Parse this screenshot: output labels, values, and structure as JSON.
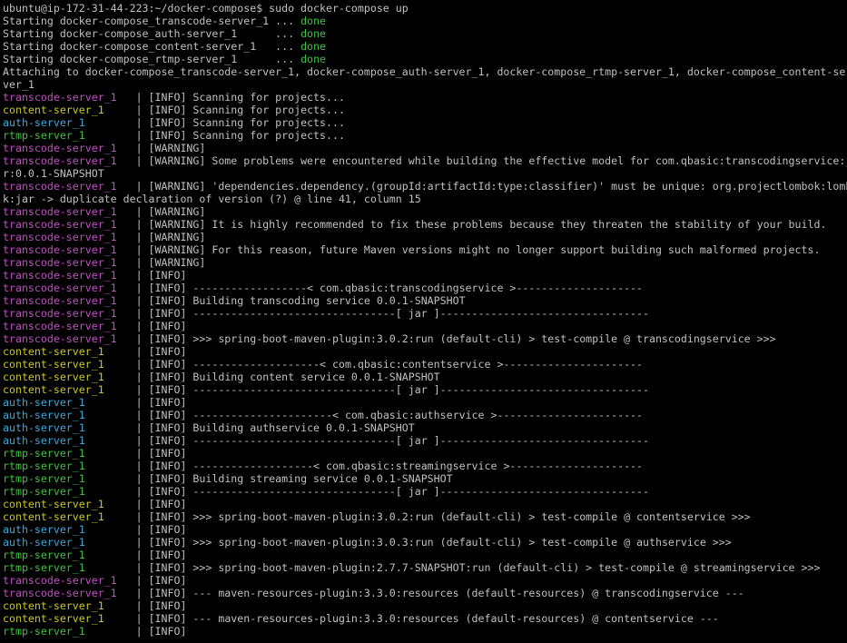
{
  "colors": {
    "background": "#000000",
    "text": "#c0c0c0",
    "transcode-server": "#c050c0",
    "content-server": "#c8c828",
    "auth-server": "#3aa8d8",
    "rtmp-server": "#40c040",
    "done": "#40c040"
  },
  "prompt": {
    "text": "ubuntu@ip-172-31-44-223:~/docker-compose$ sudo docker-compose up"
  },
  "starting": [
    {
      "prefix": "Starting docker-compose_transcode-server_1 ... ",
      "status": "done"
    },
    {
      "prefix": "Starting docker-compose_auth-server_1      ... ",
      "status": "done"
    },
    {
      "prefix": "Starting docker-compose_content-server_1   ... ",
      "status": "done"
    },
    {
      "prefix": "Starting docker-compose_rtmp-server_1      ... ",
      "status": "done"
    }
  ],
  "attaching": [
    "Attaching to docker-compose_transcode-server_1, docker-compose_auth-server_1, docker-compose_rtmp-server_1, docker-compose_content-se",
    "ver_1"
  ],
  "logs": [
    {
      "service": "transcode",
      "label": "transcode-server_1",
      "message": "[INFO] Scanning for projects..."
    },
    {
      "service": "content",
      "label": "content-server_1",
      "message": "[INFO] Scanning for projects..."
    },
    {
      "service": "auth",
      "label": "auth-server_1",
      "message": "[INFO] Scanning for projects..."
    },
    {
      "service": "rtmp",
      "label": "rtmp-server_1",
      "message": "[INFO] Scanning for projects..."
    },
    {
      "service": "transcode",
      "label": "transcode-server_1",
      "message": "[WARNING]"
    },
    {
      "service": "transcode",
      "label": "transcode-server_1",
      "message": "[WARNING] Some problems were encountered while building the effective model for com.qbasic:transcodingservice:j"
    },
    {
      "service": "plain",
      "label": "",
      "message": "r:0.0.1-SNAPSHOT"
    },
    {
      "service": "transcode",
      "label": "transcode-server_1",
      "message": "[WARNING] 'dependencies.dependency.(groupId:artifactId:type:classifier)' must be unique: org.projectlombok:lomb"
    },
    {
      "service": "plain",
      "label": "",
      "message": "k:jar -> duplicate declaration of version (?) @ line 41, column 15"
    },
    {
      "service": "transcode",
      "label": "transcode-server_1",
      "message": "[WARNING]"
    },
    {
      "service": "transcode",
      "label": "transcode-server_1",
      "message": "[WARNING] It is highly recommended to fix these problems because they threaten the stability of your build."
    },
    {
      "service": "transcode",
      "label": "transcode-server_1",
      "message": "[WARNING]"
    },
    {
      "service": "transcode",
      "label": "transcode-server_1",
      "message": "[WARNING] For this reason, future Maven versions might no longer support building such malformed projects."
    },
    {
      "service": "transcode",
      "label": "transcode-server_1",
      "message": "[WARNING]"
    },
    {
      "service": "transcode",
      "label": "transcode-server_1",
      "message": "[INFO]"
    },
    {
      "service": "transcode",
      "label": "transcode-server_1",
      "message": "[INFO] ------------------< com.qbasic:transcodingservice >--------------------"
    },
    {
      "service": "transcode",
      "label": "transcode-server_1",
      "message": "[INFO] Building transcoding service 0.0.1-SNAPSHOT"
    },
    {
      "service": "transcode",
      "label": "transcode-server_1",
      "message": "[INFO] --------------------------------[ jar ]---------------------------------"
    },
    {
      "service": "transcode",
      "label": "transcode-server_1",
      "message": "[INFO]"
    },
    {
      "service": "transcode",
      "label": "transcode-server_1",
      "message": "[INFO] >>> spring-boot-maven-plugin:3.0.2:run (default-cli) > test-compile @ transcodingservice >>>"
    },
    {
      "service": "content",
      "label": "content-server_1",
      "message": "[INFO]"
    },
    {
      "service": "content",
      "label": "content-server_1",
      "message": "[INFO] --------------------< com.qbasic:contentservice >----------------------"
    },
    {
      "service": "content",
      "label": "content-server_1",
      "message": "[INFO] Building content service 0.0.1-SNAPSHOT"
    },
    {
      "service": "content",
      "label": "content-server_1",
      "message": "[INFO] --------------------------------[ jar ]---------------------------------"
    },
    {
      "service": "auth",
      "label": "auth-server_1",
      "message": "[INFO]"
    },
    {
      "service": "auth",
      "label": "auth-server_1",
      "message": "[INFO] ----------------------< com.qbasic:authservice >-----------------------"
    },
    {
      "service": "auth",
      "label": "auth-server_1",
      "message": "[INFO] Building authservice 0.0.1-SNAPSHOT"
    },
    {
      "service": "auth",
      "label": "auth-server_1",
      "message": "[INFO] --------------------------------[ jar ]---------------------------------"
    },
    {
      "service": "rtmp",
      "label": "rtmp-server_1",
      "message": "[INFO]"
    },
    {
      "service": "rtmp",
      "label": "rtmp-server_1",
      "message": "[INFO] -------------------< com.qbasic:streamingservice >---------------------"
    },
    {
      "service": "rtmp",
      "label": "rtmp-server_1",
      "message": "[INFO] Building streaming service 0.0.1-SNAPSHOT"
    },
    {
      "service": "rtmp",
      "label": "rtmp-server_1",
      "message": "[INFO] --------------------------------[ jar ]---------------------------------"
    },
    {
      "service": "content",
      "label": "content-server_1",
      "message": "[INFO]"
    },
    {
      "service": "content",
      "label": "content-server_1",
      "message": "[INFO] >>> spring-boot-maven-plugin:3.0.2:run (default-cli) > test-compile @ contentservice >>>"
    },
    {
      "service": "auth",
      "label": "auth-server_1",
      "message": "[INFO]"
    },
    {
      "service": "auth",
      "label": "auth-server_1",
      "message": "[INFO] >>> spring-boot-maven-plugin:3.0.3:run (default-cli) > test-compile @ authservice >>>"
    },
    {
      "service": "rtmp",
      "label": "rtmp-server_1",
      "message": "[INFO]"
    },
    {
      "service": "rtmp",
      "label": "rtmp-server_1",
      "message": "[INFO] >>> spring-boot-maven-plugin:2.7.7-SNAPSHOT:run (default-cli) > test-compile @ streamingservice >>>"
    },
    {
      "service": "transcode",
      "label": "transcode-server_1",
      "message": "[INFO]"
    },
    {
      "service": "transcode",
      "label": "transcode-server_1",
      "message": "[INFO] --- maven-resources-plugin:3.3.0:resources (default-resources) @ transcodingservice ---"
    },
    {
      "service": "content",
      "label": "content-server_1",
      "message": "[INFO]"
    },
    {
      "service": "content",
      "label": "content-server_1",
      "message": "[INFO] --- maven-resources-plugin:3.3.0:resources (default-resources) @ contentservice ---"
    },
    {
      "service": "rtmp",
      "label": "rtmp-server_1",
      "message": "[INFO]"
    }
  ]
}
